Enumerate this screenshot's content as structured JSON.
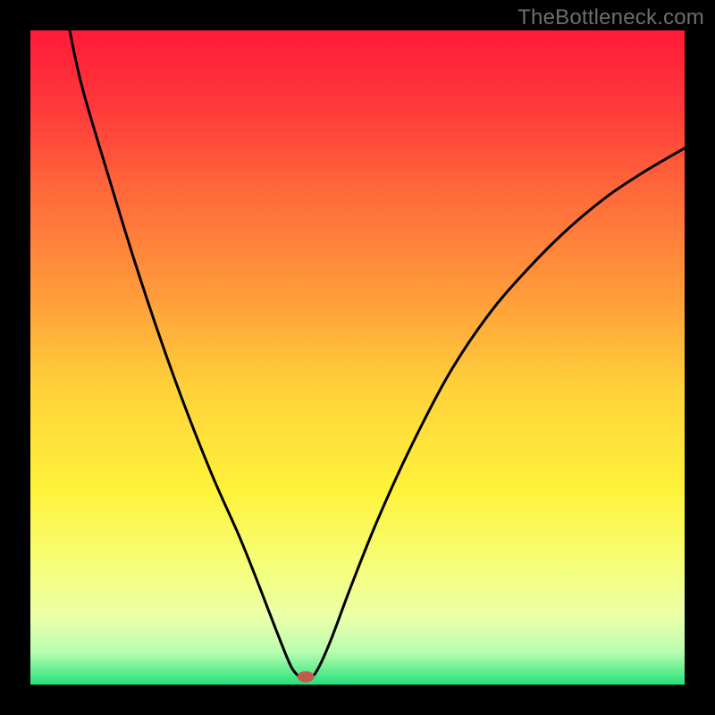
{
  "watermark": "TheBottleneck.com",
  "chart_data": {
    "type": "line",
    "title": "",
    "xlabel": "",
    "ylabel": "",
    "xlim": [
      0,
      100
    ],
    "ylim": [
      0,
      100
    ],
    "background_gradient": {
      "stops": [
        {
          "offset": 0,
          "color": "#ff1a3a"
        },
        {
          "offset": 12,
          "color": "#ff3a3a"
        },
        {
          "offset": 25,
          "color": "#ff6a3a"
        },
        {
          "offset": 40,
          "color": "#ff9a3a"
        },
        {
          "offset": 55,
          "color": "#ffd23a"
        },
        {
          "offset": 70,
          "color": "#fff23a"
        },
        {
          "offset": 82,
          "color": "#f6ff7a"
        },
        {
          "offset": 90,
          "color": "#eaffab"
        },
        {
          "offset": 95,
          "color": "#b8ffb0"
        },
        {
          "offset": 100,
          "color": "#26e07a"
        }
      ]
    },
    "series": [
      {
        "name": "bottleneck-curve",
        "color": "#000000",
        "type": "line",
        "points": [
          {
            "x": 6.0,
            "y": 100.0
          },
          {
            "x": 8.0,
            "y": 91.0
          },
          {
            "x": 12.0,
            "y": 77.5
          },
          {
            "x": 16.0,
            "y": 64.5
          },
          {
            "x": 20.0,
            "y": 52.5
          },
          {
            "x": 24.0,
            "y": 41.5
          },
          {
            "x": 28.0,
            "y": 31.5
          },
          {
            "x": 32.0,
            "y": 22.5
          },
          {
            "x": 35.0,
            "y": 15.0
          },
          {
            "x": 37.5,
            "y": 8.5
          },
          {
            "x": 39.5,
            "y": 3.5
          },
          {
            "x": 40.5,
            "y": 1.8
          },
          {
            "x": 41.4,
            "y": 1.2
          },
          {
            "x": 42.9,
            "y": 1.2
          },
          {
            "x": 44.0,
            "y": 2.5
          },
          {
            "x": 46.0,
            "y": 7.0
          },
          {
            "x": 49.0,
            "y": 15.0
          },
          {
            "x": 53.0,
            "y": 25.0
          },
          {
            "x": 58.0,
            "y": 36.0
          },
          {
            "x": 64.0,
            "y": 47.5
          },
          {
            "x": 70.0,
            "y": 56.5
          },
          {
            "x": 76.0,
            "y": 63.5
          },
          {
            "x": 82.0,
            "y": 69.5
          },
          {
            "x": 88.0,
            "y": 74.5
          },
          {
            "x": 94.0,
            "y": 78.5
          },
          {
            "x": 100.0,
            "y": 82.0
          }
        ]
      }
    ],
    "marker": {
      "name": "optimal-point",
      "x": 42.1,
      "y": 1.2,
      "rx": 1.3,
      "ry": 0.85,
      "color": "#c25a52"
    }
  }
}
